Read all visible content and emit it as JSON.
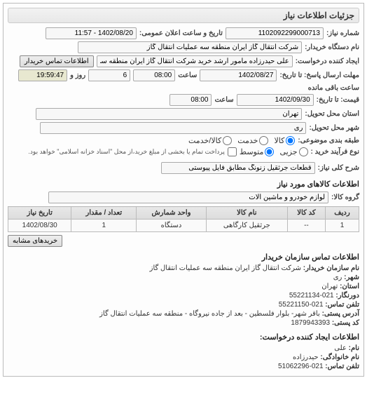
{
  "panel": {
    "title": "جزئیات اطلاعات نیاز"
  },
  "header": {
    "need_no_label": "شماره نیاز:",
    "need_no": "1102092299000713",
    "announce_label": "تاریخ و ساعت اعلان عمومی:",
    "announce_value": "1402/08/20 - 11:57",
    "buyer_org_label": "نام دستگاه خریدار:",
    "buyer_org": "شرکت انتقال گاز ایران منطقه سه عملیات انتقال گاز",
    "creator_label": "ایجاد کننده درخواست:",
    "creator": "علی حیدرزاده مامور ارشد خرید شرکت انتقال گاز ایران منطقه سه عملیات انتقال",
    "buyer_contact_btn": "اطلاعات تماس خریدار",
    "deadline_label": "مهلت ارسال پاسخ: تا تاریخ:",
    "deadline_date": "1402/08/27",
    "time_label": "ساعت",
    "deadline_time": "08:00",
    "days_left": "6",
    "days_label": "روز و",
    "countdown": "19:59:47",
    "remain_label": "ساعت باقی مانده",
    "price_to_label": "قیمت: تا تاریخ:",
    "price_date": "1402/09/30",
    "price_time": "08:00",
    "province_label": "استان محل تحویل:",
    "province": "تهران",
    "city_label": "شهر محل تحویل:",
    "city": "ری",
    "cat_label": "طبقه بندی موضوعی:",
    "cat_options": {
      "goods": "کالا",
      "service": "خدمت",
      "goods_service": "کالا/خدمت"
    },
    "proc_label": "نوع فرآیند خرید :",
    "proc_options": {
      "small": "جزیی",
      "medium": "متوسط"
    },
    "proc_note": "پرداخت تمام یا بخشی از مبلغ خرید،از محل \"اسناد خزانه اسلامی\" خواهد بود.",
    "subject_label": "شرح کلی نیاز:",
    "subject": "قطعات جرثقیل زنونگ مطابق فایل پیوستی"
  },
  "goods_section": {
    "title": "اطلاعات کالاهای مورد نیاز",
    "group_label": "گروه کالا:",
    "group": "لوازم خودرو و ماشین آلات",
    "cols": {
      "row": "ردیف",
      "code": "کد کالا",
      "name": "نام کالا",
      "unit": "واحد شمارش",
      "qty": "تعداد / مقدار",
      "need_date": "تاریخ نیاز"
    },
    "rows": [
      {
        "row": "1",
        "code": "--",
        "name": "جرثقیل کارگاهی",
        "unit": "دستگاه",
        "qty": "1",
        "need_date": "1402/08/30"
      }
    ],
    "similar_btn": "خریدهای مشابه"
  },
  "contact": {
    "title": "اطلاعات تماس سازمان خریدار",
    "org_label": "نام سازمان خریدار:",
    "org": "شرکت انتقال گاز ایران منطقه سه عملیات انتقال گاز",
    "city_label": "شهر:",
    "city": "ری",
    "province_label": "استان:",
    "province": "تهران",
    "fax_label": "دورنگار:",
    "fax": "021-55221134",
    "tel_label": "تلفن تماس:",
    "tel": "021-55221150",
    "addr_label": "آدرس پستی:",
    "addr": "باقر شهر- بلوار فلسطین - بعد از جاده نیروگاه - منطقه سه عملیات انتقال گاز",
    "post_label": "کد پستی:",
    "post": "1879943393"
  },
  "creator_info": {
    "title": "اطلاعات ایجاد کننده درخواست:",
    "name_label": "نام:",
    "name": "علی",
    "family_label": "نام خانوادگی:",
    "family": "حیدرزاده",
    "tel_label": "تلفن تماس:",
    "tel": "021-51062296"
  }
}
